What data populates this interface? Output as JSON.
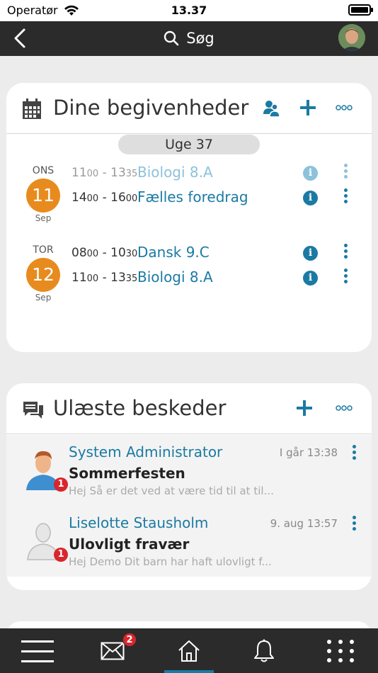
{
  "status_bar": {
    "carrier": "Operatør",
    "time": "13.37"
  },
  "nav": {
    "search_label": "Søg"
  },
  "events_card": {
    "title": "Dine begivenheder",
    "week_label": "Uge 37",
    "days": [
      {
        "weekday": "ONS",
        "day": "11",
        "month": "Sep",
        "events": [
          {
            "start_h": "11",
            "start_m": "00",
            "end_h": "13",
            "end_m": "35",
            "title": "Biologi 8.A",
            "past": true
          },
          {
            "start_h": "14",
            "start_m": "00",
            "end_h": "16",
            "end_m": "00",
            "title": "Fælles foredrag",
            "past": false
          }
        ]
      },
      {
        "weekday": "TOR",
        "day": "12",
        "month": "Sep",
        "events": [
          {
            "start_h": "08",
            "start_m": "00",
            "end_h": "10",
            "end_m": "30",
            "title": "Dansk 9.C",
            "past": false
          },
          {
            "start_h": "11",
            "start_m": "00",
            "end_h": "13",
            "end_m": "35",
            "title": "Biologi 8.A",
            "past": false
          }
        ]
      }
    ]
  },
  "messages_card": {
    "title": "Ulæste beskeder",
    "messages": [
      {
        "sender": "System Administrator",
        "date": "I går 13:38",
        "subject": "Sommerfesten",
        "preview": "Hej Så er det ved at være tid til at til...",
        "badge": "1"
      },
      {
        "sender": "Liselotte Stausholm",
        "date": "9. aug 13:57",
        "subject": "Ulovligt fravær",
        "preview": "Hej Demo Dit barn har haft ulovligt f...",
        "badge": "1"
      }
    ]
  },
  "tab_bar": {
    "messages_badge": "2"
  },
  "colors": {
    "accent": "#1b7aa3",
    "date_circle": "#e88b1e",
    "badge": "#d9262c",
    "bars": "#2b2b2b"
  }
}
